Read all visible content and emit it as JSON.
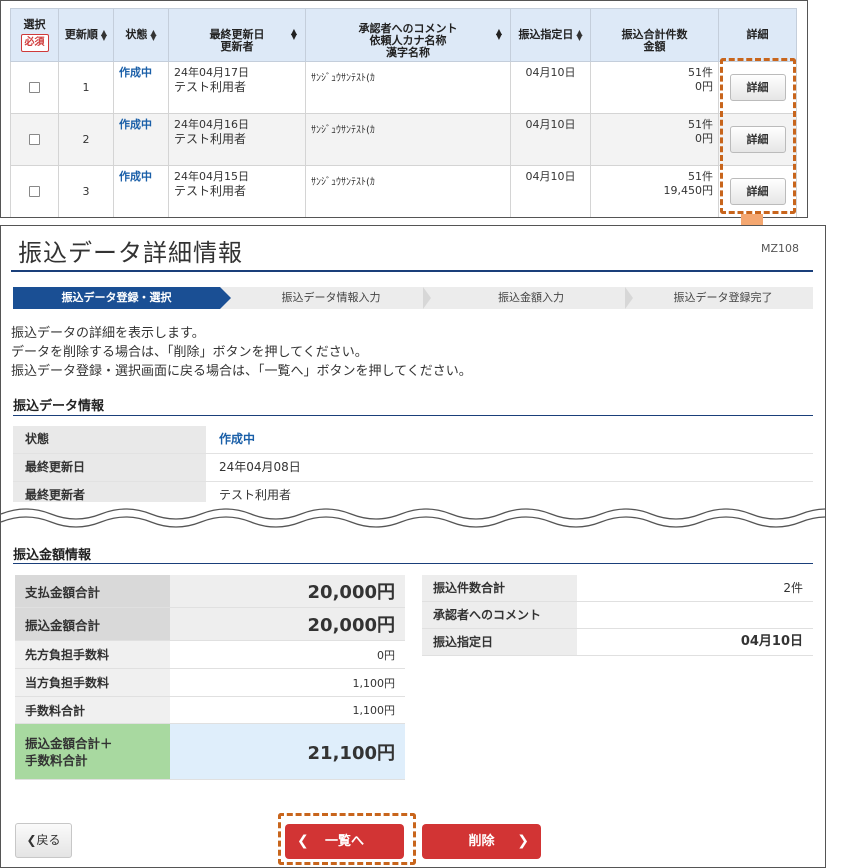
{
  "list": {
    "headers": {
      "select": "選択",
      "required": "必須",
      "order": "更新順",
      "status": "状態",
      "updated": "最終更新日\n更新者",
      "comment": "承認者へのコメント\n依頼人カナ名称\n漢字名称",
      "transfer_date": "振込指定日",
      "count_amount": "振込合計件数\n金額",
      "detail": "詳細"
    },
    "rows": [
      {
        "order": "1",
        "status": "作成中",
        "date": "24年04月17日",
        "user": "テスト利用者",
        "kana": "ｻﾝｼﾞｭｳｻﾝﾃｽﾄ(ｶ",
        "transfer_date": "04月10日",
        "count": "51件",
        "amount": "0円",
        "detail": "詳細"
      },
      {
        "order": "2",
        "status": "作成中",
        "date": "24年04月16日",
        "user": "テスト利用者",
        "kana": "ｻﾝｼﾞｭｳｻﾝﾃｽﾄ(ｶ",
        "transfer_date": "04月10日",
        "count": "51件",
        "amount": "0円",
        "detail": "詳細"
      },
      {
        "order": "3",
        "status": "作成中",
        "date": "24年04月15日",
        "user": "テスト利用者",
        "kana": "ｻﾝｼﾞｭｳｻﾝﾃｽﾄ(ｶ",
        "transfer_date": "04月10日",
        "count": "51件",
        "amount": "19,450円",
        "detail": "詳細"
      }
    ]
  },
  "detail": {
    "title": "振込データ詳細情報",
    "screen_id": "MZ108",
    "steps": [
      "振込データ登録・選択",
      "振込データ情報入力",
      "振込金額入力",
      "振込データ登録完了"
    ],
    "description": [
      "振込データの詳細を表示します。",
      "データを削除する場合は、「削除」ボタンを押してください。",
      "振込データ登録・選択画面に戻る場合は、「一覧へ」ボタンを押してください。"
    ],
    "data_section": {
      "title": "振込データ情報",
      "rows": [
        {
          "label": "状態",
          "value": "作成中"
        },
        {
          "label": "最終更新日",
          "value": "24年04月08日"
        },
        {
          "label": "最終更新者",
          "value": "テスト利用者"
        }
      ]
    },
    "amount_section": {
      "title": "振込金額情報",
      "left": [
        {
          "label": "支払金額合計",
          "value": "20,000円"
        },
        {
          "label": "振込金額合計",
          "value": "20,000円"
        },
        {
          "label": "先方負担手数料",
          "value": "0円"
        },
        {
          "label": "当方負担手数料",
          "value": "1,100円"
        },
        {
          "label": "手数料合計",
          "value": "1,100円"
        },
        {
          "label": "振込金額合計＋\n手数料合計",
          "value": "21,100円"
        }
      ],
      "right": [
        {
          "label": "振込件数合計",
          "value": "2件"
        },
        {
          "label": "承認者へのコメント",
          "value": ""
        },
        {
          "label": "振込指定日",
          "value": "04月10日"
        }
      ]
    },
    "buttons": {
      "back": "戻る",
      "list": "一覧へ",
      "delete": "削除"
    }
  },
  "colors": {
    "accent_blue": "#1a4f94",
    "status_blue": "#1a5fa8",
    "action_red": "#d23434",
    "highlight_orange": "#c8651c",
    "arrow_orange": "#f4a770",
    "total_label_green": "#a8d9a0",
    "total_value_blue": "#dfeefb"
  }
}
